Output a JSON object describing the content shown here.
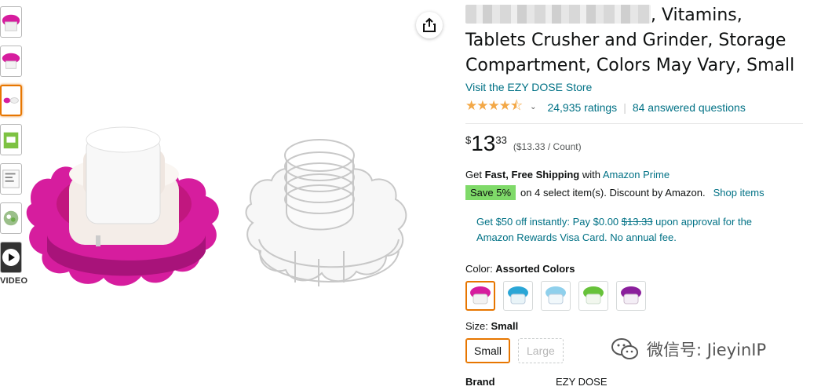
{
  "thumbnails": {
    "items": [
      {
        "name": "thumb-pink-crusher",
        "color": "#d61d9e"
      },
      {
        "name": "thumb-pink-crusher-alt",
        "color": "#d61d9e"
      },
      {
        "name": "thumb-pink-parts",
        "color": "#d61d9e"
      },
      {
        "name": "thumb-green-crusher",
        "color": "#7dc242"
      },
      {
        "name": "thumb-info",
        "color": "#888888"
      },
      {
        "name": "thumb-green-pills",
        "color": "#6cae4a"
      }
    ],
    "video_label": "VIDEO"
  },
  "product": {
    "title_visible": ", Vitamins, Tablets Crusher and Grinder, Storage Compartment, Colors May Vary, Small",
    "store_link": "Visit the EZY DOSE Store",
    "rating_value": 4.5,
    "stars": "★★★★⯪",
    "ratings_count": "24,935 ratings",
    "answered_questions": "84 answered questions",
    "price_symbol": "$",
    "price_whole": "13",
    "price_fraction": "33",
    "unit_price": "($13.33 / Count)",
    "shipping_prefix": "Get ",
    "shipping_bold": "Fast, Free Shipping",
    "shipping_mid": " with ",
    "shipping_link": "Amazon Prime",
    "save_badge": "Save 5%",
    "save_text": "on 4 select item(s). Discount by Amazon.",
    "shop_items": "Shop items",
    "promo_prefix": "Get $50 off instantly: Pay $0.00 ",
    "promo_strike": "$13.33",
    "promo_suffix": " upon approval for the Amazon Rewards Visa Card. No annual fee.",
    "color_label": "Color: ",
    "color_value": "Assorted Colors",
    "swatches": [
      {
        "name": "swatch-pink",
        "color": "#d61d9e",
        "selected": true
      },
      {
        "name": "swatch-teal",
        "color": "#2aa6d6",
        "selected": false
      },
      {
        "name": "swatch-light-blue",
        "color": "#8fd0ec",
        "selected": false
      },
      {
        "name": "swatch-green",
        "color": "#67c23a",
        "selected": false
      },
      {
        "name": "swatch-purple",
        "color": "#8a1f9c",
        "selected": false
      }
    ],
    "size_label": "Size: ",
    "size_value": "Small",
    "sizes": [
      {
        "label": "Small",
        "selected": true
      },
      {
        "label": "Large",
        "selected": false
      }
    ],
    "brand_key": "Brand",
    "brand_value": "EZY DOSE"
  },
  "watermark": {
    "text": "微信号: JieyinIP"
  },
  "colors": {
    "link": "#007185",
    "star": "#f3a847",
    "selected_border": "#e77600",
    "save_badge": "#7fda69",
    "product_magenta": "#d61d9e"
  }
}
